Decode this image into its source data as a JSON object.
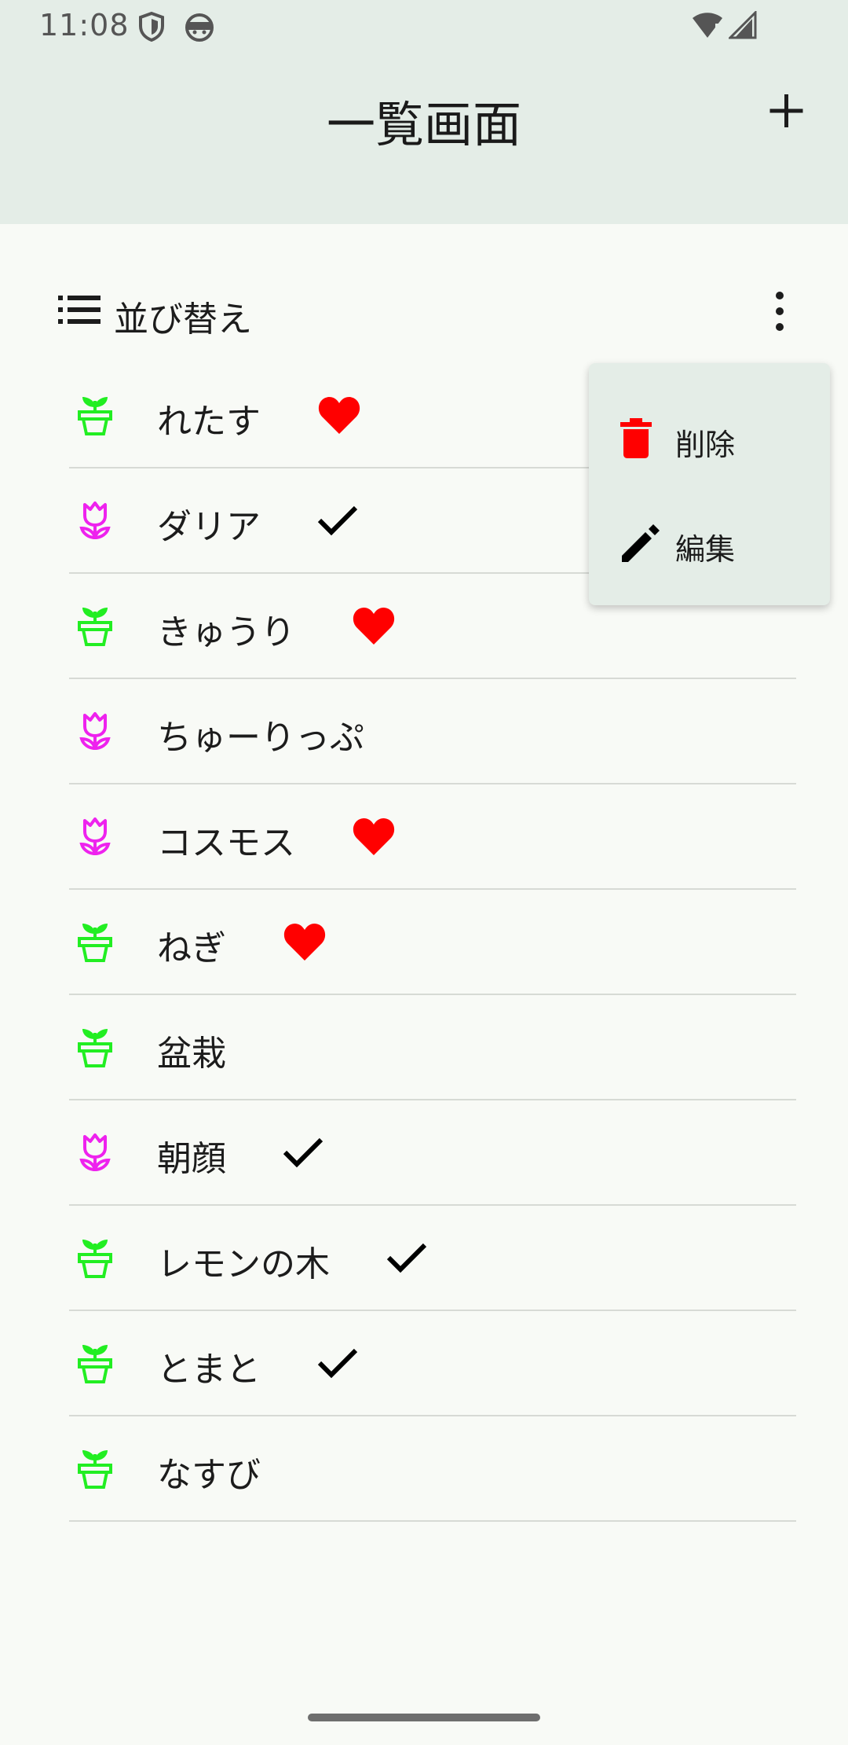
{
  "status_bar": {
    "time": "11:08",
    "icons": [
      "shield-icon",
      "android-face-icon",
      "wifi-icon",
      "signal-icon"
    ]
  },
  "header": {
    "title": "一覧画面",
    "add_icon": "plus-icon"
  },
  "sort": {
    "label": "並び替え",
    "icon": "list-icon",
    "more_icon": "more-vert-icon"
  },
  "overflow_menu": {
    "items": [
      {
        "label": "削除",
        "icon": "trash-icon",
        "color": "#ff0000"
      },
      {
        "label": "編集",
        "icon": "pencil-icon",
        "color": "#000000"
      }
    ]
  },
  "colors": {
    "sprout": "#22ee22",
    "tulip": "#ee22ee",
    "heart": "#ff0000",
    "check": "#000000"
  },
  "plants": [
    {
      "name": "れたす",
      "type": "sprout",
      "mark": "heart"
    },
    {
      "name": "ダリア",
      "type": "tulip",
      "mark": "check"
    },
    {
      "name": "きゅうり",
      "type": "sprout",
      "mark": "heart"
    },
    {
      "name": "ちゅーりっぷ",
      "type": "tulip",
      "mark": "none"
    },
    {
      "name": "コスモス",
      "type": "tulip",
      "mark": "heart"
    },
    {
      "name": "ねぎ",
      "type": "sprout",
      "mark": "heart"
    },
    {
      "name": "盆栽",
      "type": "sprout",
      "mark": "none"
    },
    {
      "name": "朝顔",
      "type": "tulip",
      "mark": "check"
    },
    {
      "name": "レモンの木",
      "type": "sprout",
      "mark": "check"
    },
    {
      "name": "とまと",
      "type": "sprout",
      "mark": "check"
    },
    {
      "name": "なすび",
      "type": "sprout",
      "mark": "none"
    }
  ]
}
